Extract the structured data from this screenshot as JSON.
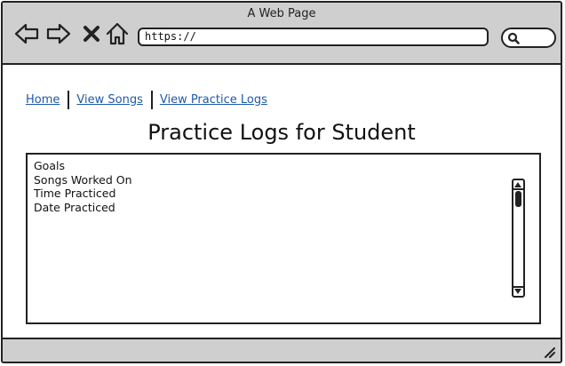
{
  "browser": {
    "window_title": "A Web Page",
    "url": "https://",
    "buttons": {
      "back": "back-arrow-icon",
      "forward": "forward-arrow-icon",
      "stop": "close-icon",
      "home": "home-icon",
      "search": "search-icon"
    }
  },
  "nav": {
    "links": [
      {
        "label": "Home"
      },
      {
        "label": "View Songs"
      },
      {
        "label": "View Practice Logs"
      }
    ]
  },
  "page": {
    "title": "Practice Logs for Student"
  },
  "log_panel": {
    "items": [
      {
        "label": "Goals"
      },
      {
        "label": "Songs Worked On"
      },
      {
        "label": "Time Practiced"
      },
      {
        "label": "Date Practiced"
      }
    ],
    "scroll_position": 0
  },
  "colors": {
    "chrome": "#cfcfcf",
    "link": "#1f5aa6",
    "stroke": "#222222"
  }
}
